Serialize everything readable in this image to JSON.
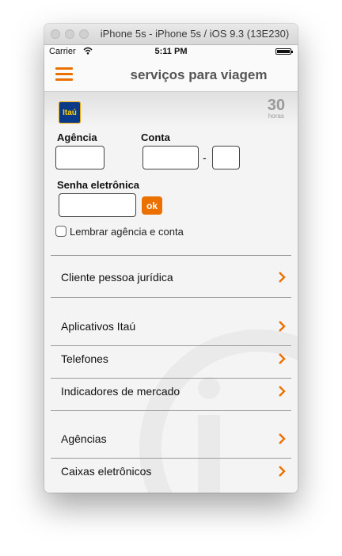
{
  "window": {
    "title": "iPhone 5s - iPhone 5s / iOS 9.3 (13E230)"
  },
  "status_bar": {
    "carrier": "Carrier",
    "time": "5:11 PM"
  },
  "nav": {
    "title": "serviços para viagem",
    "menu_icon": "hamburger-icon"
  },
  "banner": {
    "logo_text": "Itaú",
    "hours_number": "30",
    "hours_text": "horas"
  },
  "login": {
    "agencia_label": "Agência",
    "conta_label": "Conta",
    "dash": "-",
    "senha_label": "Senha eletrônica",
    "agencia_value": "",
    "conta_value": "",
    "digito_value": "",
    "senha_value": "",
    "ok_label": "ok",
    "remember_label": "Lembrar agência e conta",
    "remember_checked": false
  },
  "menu": [
    {
      "label": "Cliente pessoa jurídica"
    },
    {
      "label": "Aplicativos Itaú"
    },
    {
      "label": "Telefones"
    },
    {
      "label": "Indicadores de mercado"
    },
    {
      "label": "Agências"
    },
    {
      "label": "Caixas eletrônicos"
    }
  ],
  "colors": {
    "accent": "#ec7000",
    "itau_blue": "#0a3a87"
  }
}
